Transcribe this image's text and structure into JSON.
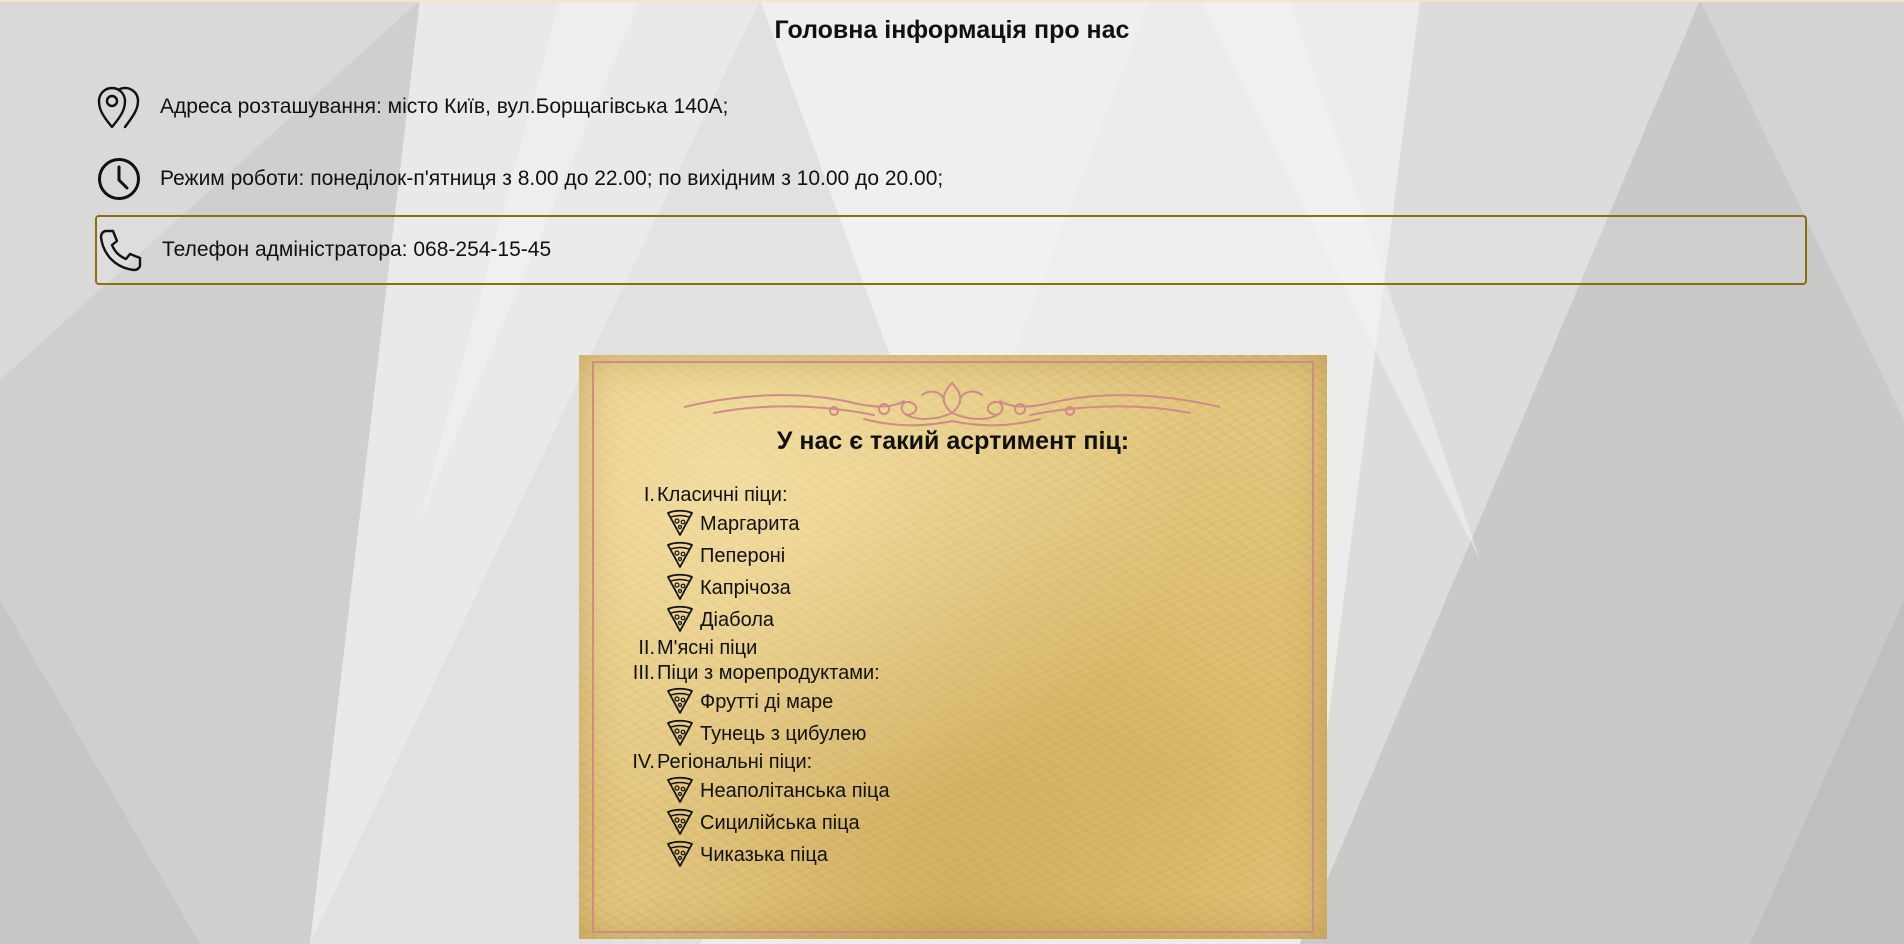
{
  "page": {
    "title": "Головна інформація про нас"
  },
  "info": {
    "address": "Адреса розташування: місто Київ, вул.Борщагівська 140А;",
    "hours": "Режим роботи: понеділок-п'ятниця з 8.00 до 22.00; по вихідним з 10.00 до 20.00;",
    "phone": "Телефон адміністратора: 068-254-15-45"
  },
  "icons": {
    "address": "map-pin-icon",
    "hours": "clock-icon",
    "phone": "phone-icon",
    "menu_item": "pizza-slice-icon"
  },
  "colors": {
    "highlight_border": "#8c6e0c",
    "parchment": "#e2c57c",
    "frame": "#cf8b86"
  },
  "menu": {
    "title": "У нас є такий асртимент піц:",
    "categories": [
      {
        "num": "I.",
        "label": "Класичні піци:",
        "items": [
          "Маргарита",
          "Пепероні",
          "Капрічоза",
          "Діабола"
        ]
      },
      {
        "num": "II.",
        "label": "М'ясні піци",
        "items": []
      },
      {
        "num": "III.",
        "label": "Піци з морепродуктами:",
        "items": [
          "Фрутті ді маре",
          "Тунець з цибулею"
        ]
      },
      {
        "num": "IV.",
        "label": "Регіональні піци:",
        "items": [
          "Неаполітанська піца",
          "Сицилійська піца",
          "Чиказька піца"
        ]
      }
    ]
  }
}
